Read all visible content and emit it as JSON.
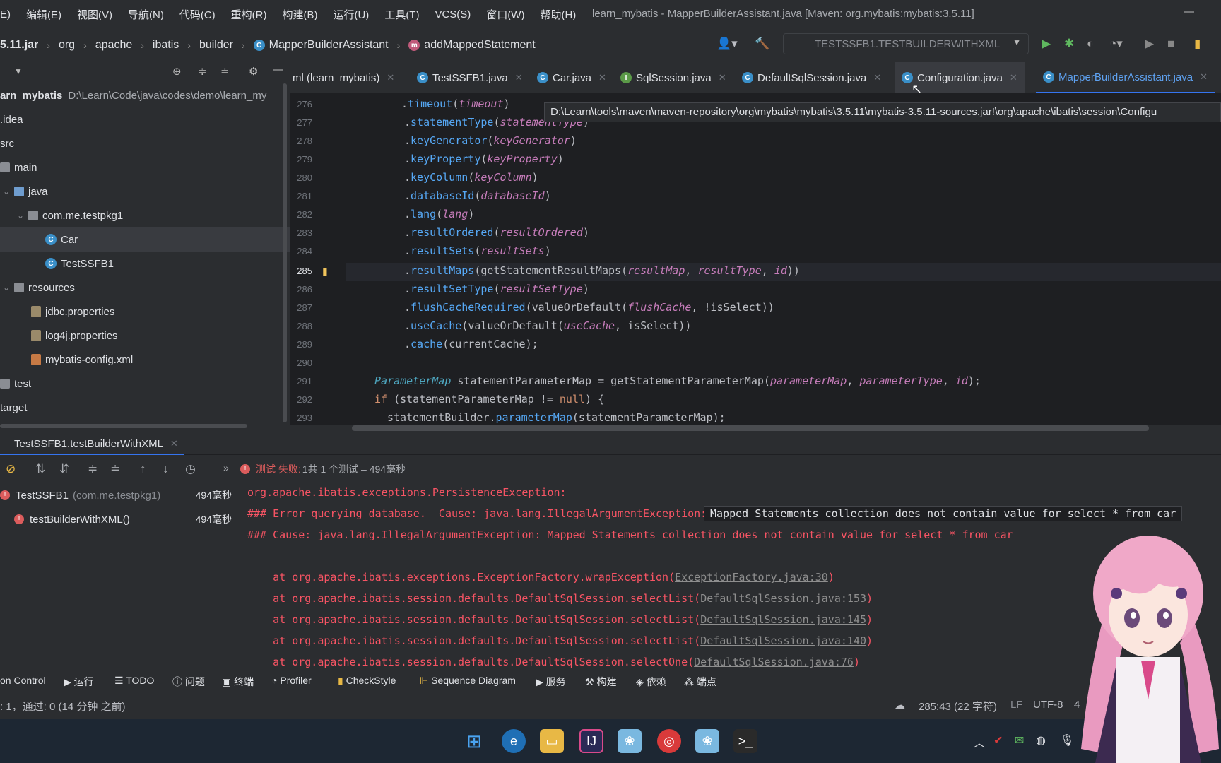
{
  "menu": {
    "items": [
      "E)",
      "编辑(E)",
      "视图(V)",
      "导航(N)",
      "代码(C)",
      "重构(R)",
      "构建(B)",
      "运行(U)",
      "工具(T)",
      "VCS(S)",
      "窗口(W)",
      "帮助(H)"
    ],
    "window_title": "learn_mybatis - MapperBuilderAssistant.java [Maven: org.mybatis:mybatis:3.5.11]"
  },
  "breadcrumb": [
    "5.11.jar",
    "org",
    "apache",
    "ibatis",
    "builder",
    "MapperBuilderAssistant",
    "addMappedStatement"
  ],
  "run_config": "TESTSSFB1.TESTBUILDERWITHXML",
  "project": {
    "root_name": "arn_mybatis",
    "root_path": "D:\\Learn\\Code\\java\\codes\\demo\\learn_my",
    "items": [
      ".idea",
      "src",
      "main",
      "java",
      "com.me.testpkg1",
      "Car",
      "TestSSFB1",
      "resources",
      "jdbc.properties",
      "log4j.properties",
      "mybatis-config.xml",
      "test",
      "target"
    ]
  },
  "tabs": [
    "ml (learn_mybatis)",
    "TestSSFB1.java",
    "Car.java",
    "SqlSession.java",
    "DefaultSqlSession.java",
    "Configuration.java",
    "MapperBuilderAssistant.java"
  ],
  "tooltip": "D:\\Learn\\tools\\maven\\maven-repository\\org\\mybatis\\mybatis\\3.5.11\\mybatis-3.5.11-sources.jar!\\org\\apache\\ibatis\\session\\Configu",
  "editor": {
    "line_numbers": [
      "276",
      "277",
      "278",
      "279",
      "280",
      "281",
      "282",
      "283",
      "284",
      "285",
      "286",
      "287",
      "288",
      "289",
      "290",
      "291",
      "292",
      "293"
    ]
  },
  "run": {
    "tab_label": "TestSSFB1.testBuilderWithXML",
    "summary_fail": "测试 失败:",
    "summary_count": "1共 1 个测试 – 494毫秒",
    "tests": [
      {
        "name": "TestSSFB1",
        "pkg": "(com.me.testpkg1)",
        "time": "494毫秒"
      },
      {
        "name": "testBuilderWithXML()",
        "pkg": "",
        "time": "494毫秒"
      }
    ],
    "console": [
      "org.apache.ibatis.exceptions.PersistenceException: ",
      "### Error querying database.  Cause: java.lang.IllegalArgumentException: ",
      "Mapped Statements collection does not contain value for select * from car",
      "### Cause: java.lang.IllegalArgumentException: Mapped Statements collection does not contain value for select * from car",
      "    at org.apache.ibatis.exceptions.ExceptionFactory.wrapException(",
      "ExceptionFactory.java:30",
      "    at org.apache.ibatis.session.defaults.DefaultSqlSession.selectList(",
      "DefaultSqlSession.java:153",
      "DefaultSqlSession.java:145",
      "DefaultSqlSession.java:140",
      "    at org.apache.ibatis.session.defaults.DefaultSqlSession.selectOne(",
      "DefaultSqlSession.java:76"
    ]
  },
  "toolwindows": [
    "on Control",
    "运行",
    "TODO",
    "问题",
    "终端",
    "Profiler",
    "CheckStyle",
    "Sequence Diagram",
    "服务",
    "构建",
    "依赖",
    "端点"
  ],
  "status": {
    "left": ": 1，通过: 0 (14 分钟 之前)",
    "position": "285:43 (22 字符)",
    "line_sep": "LF",
    "encoding": "UTF-8",
    "indent": "4"
  }
}
